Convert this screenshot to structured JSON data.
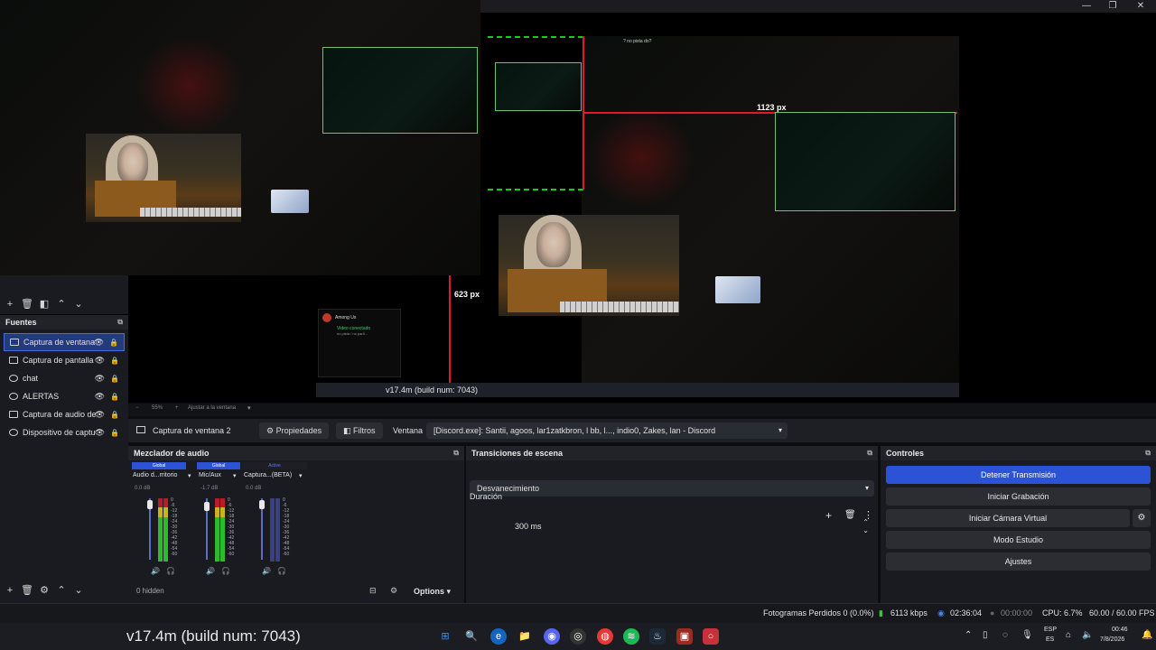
{
  "window": {
    "minimize": "—",
    "maximize": "❐",
    "close": "✕"
  },
  "preview": {
    "dim_width": "1123 px",
    "dim_height": "623 px",
    "inner_title": "? no pista do?",
    "overlay_version": "v17.4m (build num: 7043)",
    "chat_app_name": "Among Us",
    "chat_status": "Video conectado",
    "chat_sub": "no pista / no parti..."
  },
  "zoom_bar": {
    "zoom": "55%",
    "fit_label": "Ajustar a la ventana"
  },
  "sources": {
    "title": "Fuentes",
    "items": [
      {
        "label": "Captura de ventana",
        "selected": true
      },
      {
        "label": "Captura de pantalla"
      },
      {
        "label": "chat"
      },
      {
        "label": "ALERTAS"
      },
      {
        "label": "Captura de audio de"
      },
      {
        "label": "Dispositivo de captu"
      }
    ]
  },
  "context_bar": {
    "source_name": "Captura de ventana 2",
    "properties": "Propiedades",
    "filters": "Filtros",
    "window_label": "Ventana",
    "window_value": "[Discord.exe]: Santii, agoos, lar1zatkbron, l bb, l..., indio0, Zakes, lan - Discord"
  },
  "mixer": {
    "title": "Mezclador de audio",
    "channels": [
      {
        "badge": "Global",
        "name": "Audio d...rritorio",
        "db": "0.0 dB"
      },
      {
        "badge": "Global",
        "name": "Mic/Aux",
        "db": "-1.7 dB"
      },
      {
        "badge": "Active",
        "name": "Captura...(BETA)",
        "db": "0.0 dB"
      }
    ],
    "scale": [
      "0",
      "-6",
      "-12",
      "-18",
      "-24",
      "-30",
      "-36",
      "-42",
      "-48",
      "-54",
      "-60"
    ],
    "hidden": "0 hidden",
    "options": "Options"
  },
  "transitions": {
    "title": "Transiciones de escena",
    "selected": "Desvanecimiento",
    "duration_label": "Duración",
    "duration_value": "300 ms"
  },
  "controls": {
    "title": "Controles",
    "buttons": [
      "Detener Transmisión",
      "Iniciar Grabación",
      "Iniciar Cámara Virtual",
      "Modo Estudio",
      "Ajustes"
    ]
  },
  "status": {
    "dropped": "Fotogramas Perdidos 0 (0.0%)",
    "bitrate": "6113 kbps",
    "stream_time": "02:36:04",
    "rec_time": "00:00:00",
    "cpu": "CPU: 6.7%",
    "fps": "60.00 / 60.00 FPS"
  },
  "taskbar": {
    "overlay_text": "v17.4m (build num: 7043)",
    "lang_top": "ESP",
    "lang_bottom": "ES",
    "time": "00:46",
    "date": "7/8/2026"
  },
  "colors": {
    "accent": "#2c53d6",
    "selection": "#253a7a",
    "guide_red": "#e01828",
    "guide_green": "#14d014"
  }
}
